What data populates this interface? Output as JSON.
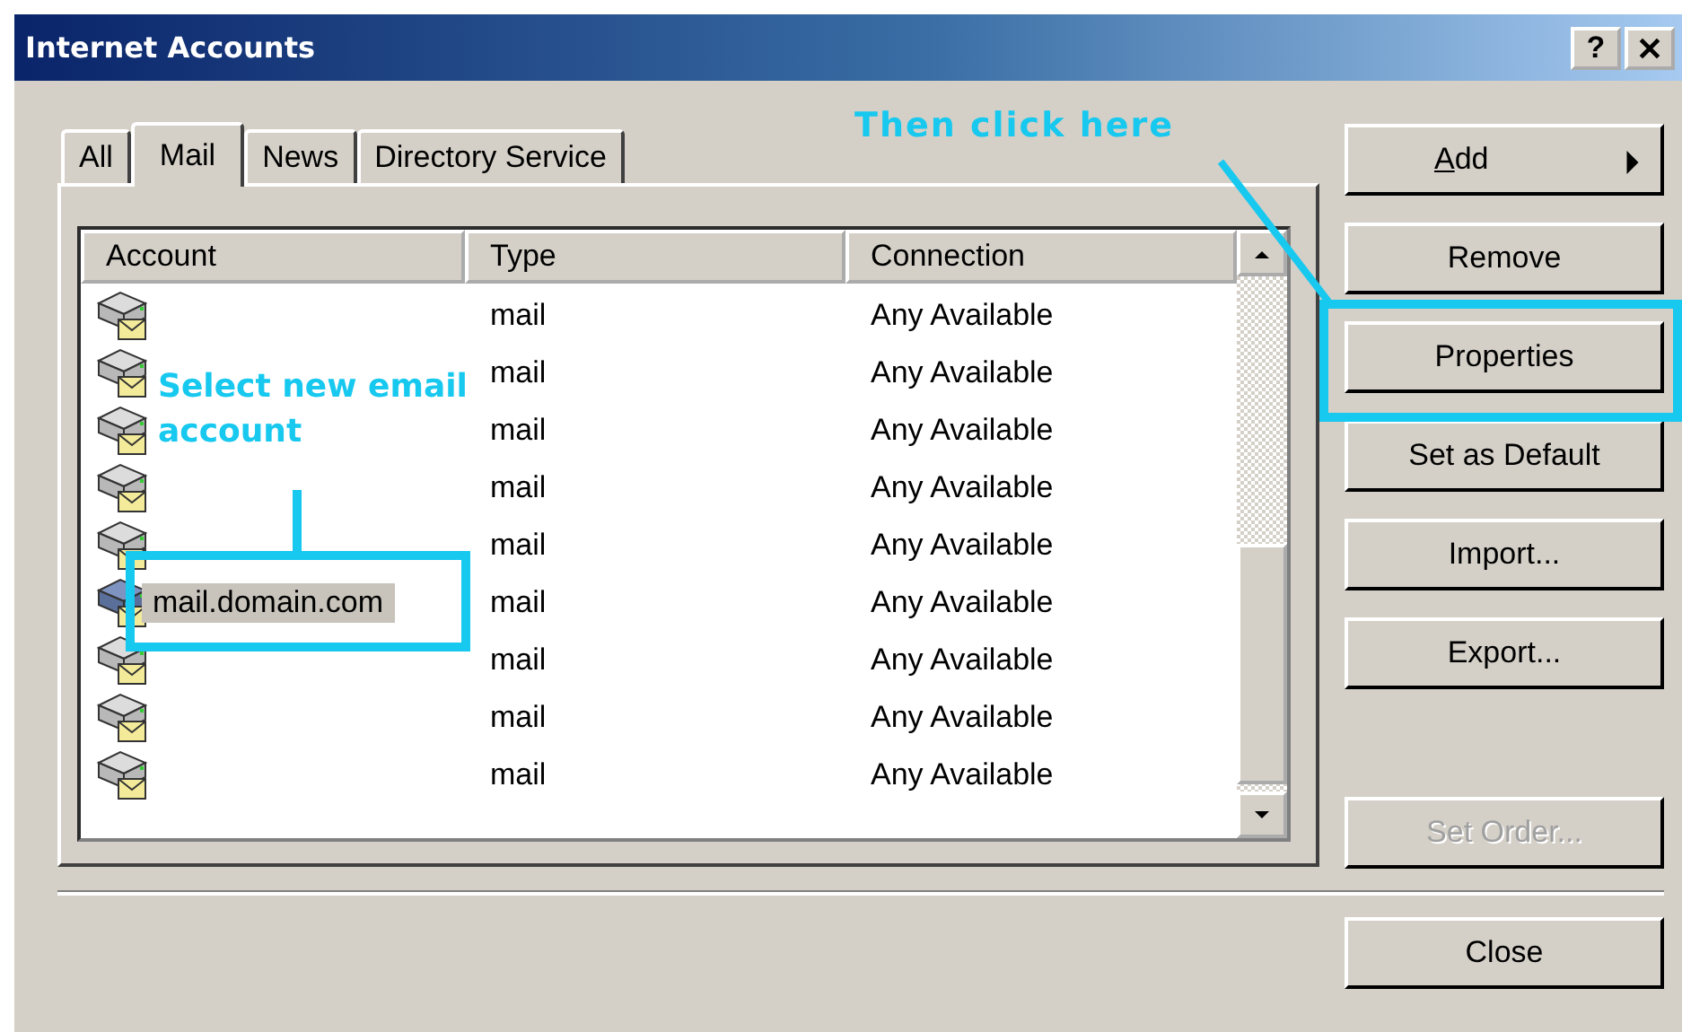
{
  "window": {
    "title": "Internet Accounts",
    "help": "?"
  },
  "tabs": [
    {
      "label": "All",
      "selected": false
    },
    {
      "label": "Mail",
      "selected": true
    },
    {
      "label": "News",
      "selected": false
    },
    {
      "label": "Directory Service",
      "selected": false
    }
  ],
  "table": {
    "columns": [
      "Account",
      "Type",
      "Connection"
    ],
    "rows": [
      {
        "type": "mail",
        "connection": "Any Available",
        "selected": false
      },
      {
        "type": "mail",
        "connection": "Any Available",
        "selected": false
      },
      {
        "type": "mail",
        "connection": "Any Available",
        "selected": false
      },
      {
        "type": "mail",
        "connection": "Any Available",
        "selected": false
      },
      {
        "type": "mail",
        "connection": "Any Available",
        "selected": false
      },
      {
        "account": "mail.domain.com",
        "type": "mail",
        "connection": "Any Available",
        "selected": true
      },
      {
        "type": "mail",
        "connection": "Any Available",
        "selected": false
      },
      {
        "type": "mail",
        "connection": "Any Available",
        "selected": false
      },
      {
        "type": "mail",
        "connection": "Any Available",
        "selected": false
      }
    ]
  },
  "buttons": [
    {
      "label": "Add",
      "kind": "menu",
      "mnemonic": true,
      "disabled": false
    },
    {
      "label": "Remove",
      "kind": "push",
      "mnemonic": false,
      "disabled": false
    },
    {
      "label": "Properties",
      "kind": "push",
      "mnemonic": false,
      "disabled": false
    },
    {
      "label": "Set as Default",
      "kind": "push",
      "mnemonic": false,
      "disabled": false
    },
    {
      "label": "Import...",
      "kind": "push",
      "mnemonic": false,
      "disabled": false
    },
    {
      "label": "Export...",
      "kind": "push",
      "mnemonic": false,
      "disabled": false
    },
    {
      "label": "Set Order...",
      "kind": "push",
      "mnemonic": false,
      "disabled": true
    }
  ],
  "close_button": "Close",
  "annotations": [
    {
      "text": "Then click here",
      "kind": "diagonal"
    },
    {
      "text": "Select new email account",
      "kind": "vertical"
    }
  ]
}
